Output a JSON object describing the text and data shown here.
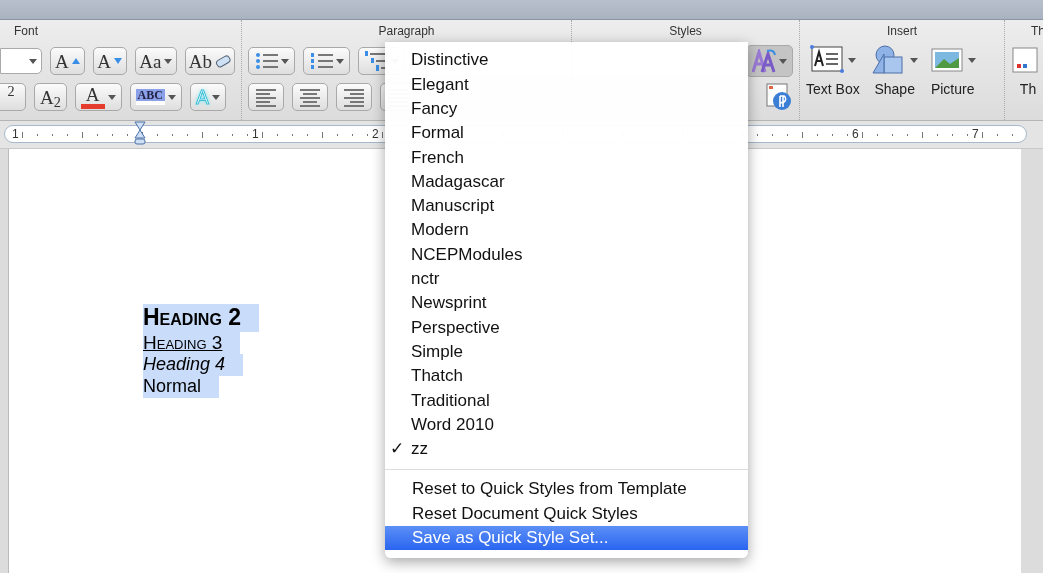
{
  "ribbon": {
    "groups": [
      {
        "title": "Font",
        "kind": "font",
        "rows": [
          [
            {
              "kind": "size-field"
            },
            {
              "kind": "grow",
              "label": "A"
            },
            {
              "kind": "shrink",
              "label": "A"
            },
            {
              "kind": "case",
              "label": "Aa"
            },
            {
              "kind": "clear",
              "label": "Ab"
            }
          ],
          [
            {
              "kind": "super",
              "label": "$^{2}$"
            },
            {
              "kind": "sub",
              "label": "A$_{2}$"
            },
            {
              "kind": "font-color",
              "label": "A"
            },
            {
              "kind": "highlight",
              "label": "ABC"
            },
            {
              "kind": "effects",
              "label": "A"
            }
          ]
        ]
      },
      {
        "title": "Paragraph",
        "kind": "paragraph",
        "rows": [
          [
            {
              "kind": "bullets"
            },
            {
              "kind": "numbering"
            },
            {
              "kind": "multilevel"
            }
          ],
          [
            {
              "kind": "align-left"
            },
            {
              "kind": "align-center"
            },
            {
              "kind": "align-right"
            },
            {
              "kind": "justify"
            }
          ]
        ]
      },
      {
        "title": "Styles",
        "kind": "styles",
        "rows": [
          [
            {
              "kind": "style-set"
            }
          ],
          [
            {
              "kind": "styles-pane"
            }
          ]
        ]
      },
      {
        "title": "Insert",
        "kind": "insert",
        "rows": [
          [
            {
              "kind": "text-box",
              "label": "Text Box"
            },
            {
              "kind": "shape",
              "label": "Shape"
            },
            {
              "kind": "picture",
              "label": "Picture"
            }
          ]
        ]
      },
      {
        "title": "Th",
        "kind": "themes",
        "rows": [
          [
            {
              "kind": "themes",
              "label": "Th"
            }
          ]
        ]
      }
    ]
  },
  "ruler": {
    "labels": [
      "1",
      "1",
      "2",
      "6",
      "7"
    ]
  },
  "document": {
    "paragraphs": [
      {
        "kind": "heading2",
        "text": "Heading 2",
        "selected": true
      },
      {
        "kind": "heading3",
        "text": "Heading 3",
        "selected": true
      },
      {
        "kind": "heading4",
        "text": "Heading 4",
        "selected": true
      },
      {
        "kind": "normal",
        "text": "Normal",
        "selected": true
      }
    ]
  },
  "menu": {
    "items": [
      {
        "label": "Distinctive",
        "checked": false
      },
      {
        "label": "Elegant",
        "checked": false
      },
      {
        "label": "Fancy",
        "checked": false
      },
      {
        "label": "Formal",
        "checked": false
      },
      {
        "label": "French",
        "checked": false
      },
      {
        "label": "Madagascar",
        "checked": false
      },
      {
        "label": "Manuscript",
        "checked": false
      },
      {
        "label": "Modern",
        "checked": false
      },
      {
        "label": "NCEPModules",
        "checked": false
      },
      {
        "label": "nctr",
        "checked": false
      },
      {
        "label": "Newsprint",
        "checked": false
      },
      {
        "label": "Perspective",
        "checked": false
      },
      {
        "label": "Simple",
        "checked": false
      },
      {
        "label": "Thatch",
        "checked": false
      },
      {
        "label": "Traditional",
        "checked": false
      },
      {
        "label": "Word 2010",
        "checked": false
      },
      {
        "label": "zz",
        "checked": true
      }
    ],
    "check_mark": "✓",
    "actions": [
      {
        "label": "Reset to Quick Styles from Template",
        "selected": false
      },
      {
        "label": "Reset Document Quick Styles",
        "selected": false
      },
      {
        "label": "Save as Quick Style Set...",
        "selected": true
      }
    ]
  }
}
